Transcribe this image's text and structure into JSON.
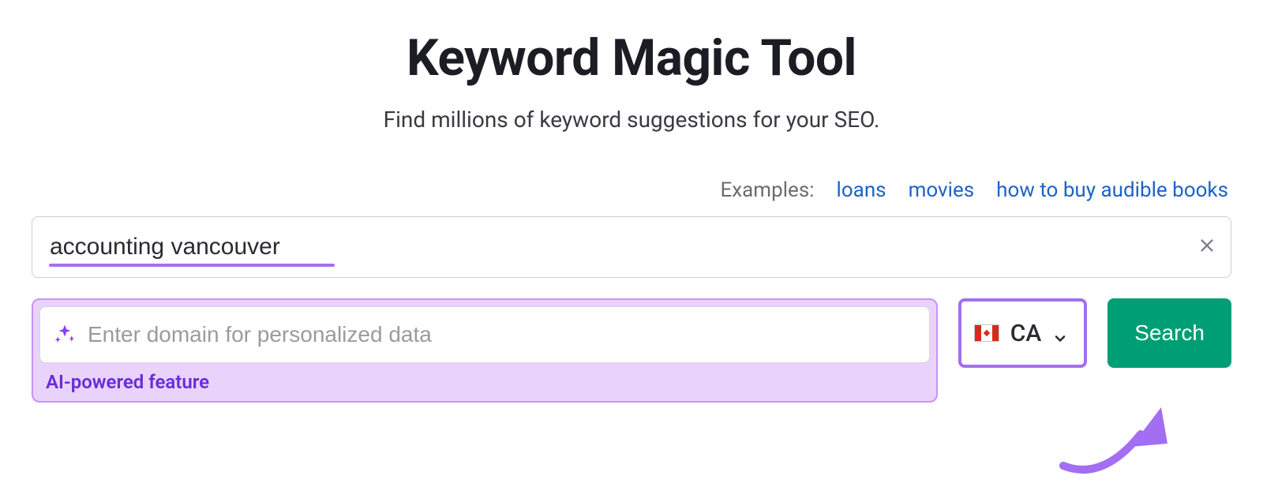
{
  "header": {
    "title": "Keyword Magic Tool",
    "subtitle": "Find millions of keyword suggestions for your SEO."
  },
  "examples": {
    "label": "Examples:",
    "links": [
      "loans",
      "movies",
      "how to buy audible books"
    ]
  },
  "keyword_input": {
    "value": "accounting vancouver"
  },
  "domain_input": {
    "placeholder": "Enter domain for personalized data",
    "ai_label": "AI-powered feature"
  },
  "country_select": {
    "code": "CA"
  },
  "search_button": {
    "label": "Search"
  }
}
